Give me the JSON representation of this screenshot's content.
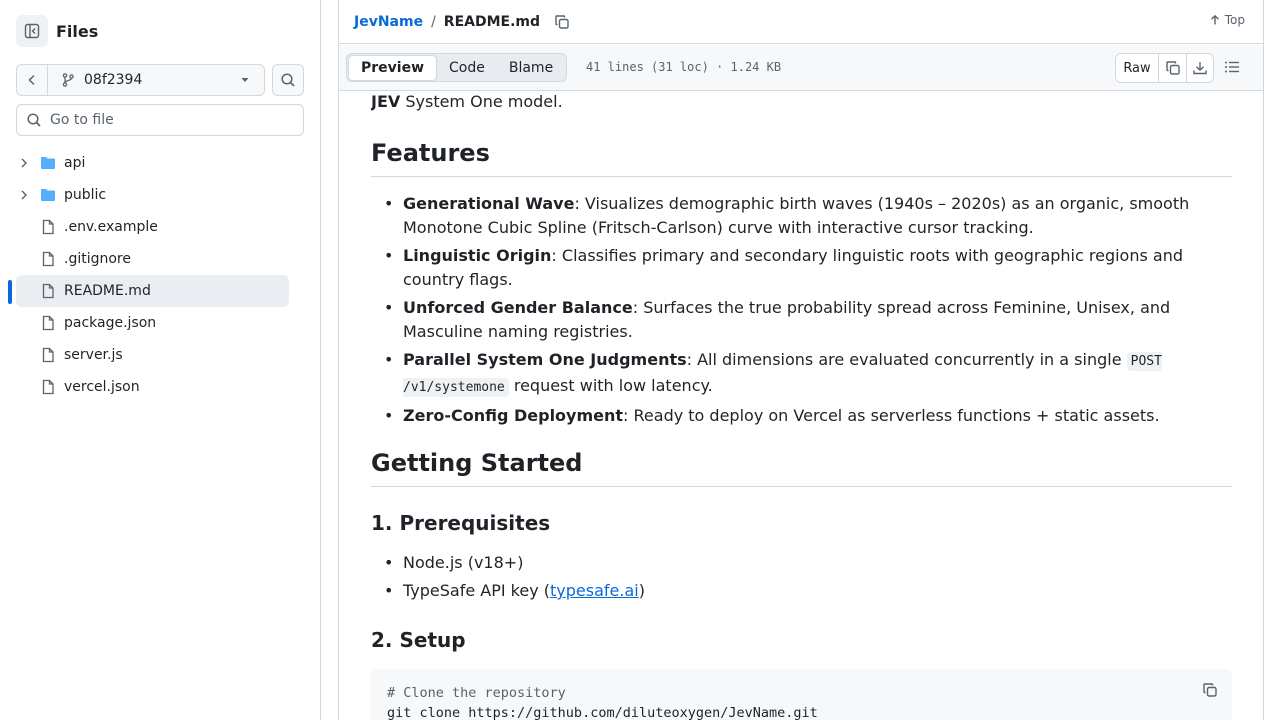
{
  "sidebar": {
    "title": "Files",
    "branch": "08f2394",
    "goto_placeholder": "Go to file",
    "items": [
      {
        "label": "api",
        "type": "folder"
      },
      {
        "label": "public",
        "type": "folder"
      },
      {
        "label": ".env.example",
        "type": "file"
      },
      {
        "label": ".gitignore",
        "type": "file"
      },
      {
        "label": "README.md",
        "type": "file",
        "selected": true
      },
      {
        "label": "package.json",
        "type": "file"
      },
      {
        "label": "server.js",
        "type": "file"
      },
      {
        "label": "vercel.json",
        "type": "file"
      }
    ]
  },
  "header": {
    "repo": "JevName",
    "separator": "/",
    "file": "README.md",
    "top_label": "Top"
  },
  "toolbar": {
    "tabs": [
      {
        "label": "Preview",
        "active": true
      },
      {
        "label": "Code",
        "active": false
      },
      {
        "label": "Blame",
        "active": false
      }
    ],
    "file_meta": "41 lines (31 loc) · 1.24 KB",
    "raw_label": "Raw"
  },
  "content": {
    "intro_bold": "JEV",
    "intro_rest": " System One model.",
    "features_heading": "Features",
    "features": [
      {
        "bold": "Generational Wave",
        "text": ": Visualizes demographic birth waves (1940s – 2020s) as an organic, smooth Monotone Cubic Spline (Fritsch-Carlson) curve with interactive cursor tracking."
      },
      {
        "bold": "Linguistic Origin",
        "text": ": Classifies primary and secondary linguistic roots with geographic regions and country flags."
      },
      {
        "bold": "Unforced Gender Balance",
        "text": ": Surfaces the true probability spread across Feminine, Unisex, and Masculine naming registries."
      },
      {
        "bold": "Parallel System One Judgments",
        "text_before": ": All dimensions are evaluated concurrently in a single ",
        "code": "POST /v1/systemone",
        "text_after": " request with low latency."
      },
      {
        "bold": "Zero-Config Deployment",
        "text": ": Ready to deploy on Vercel as serverless functions + static assets."
      }
    ],
    "getting_started_heading": "Getting Started",
    "prereq_heading": "1. Prerequisites",
    "prereq_node": "Node.js (v18+)",
    "prereq_key_before": "TypeSafe API key (",
    "prereq_key_link": "typesafe.ai",
    "prereq_key_after": ")",
    "setup_heading": "2. Setup",
    "code_comment": "# Clone the repository",
    "code_line": "git clone https://github.com/diluteoxygen/JevName.git"
  },
  "colors": {
    "accent": "#0969da",
    "border": "#d1d9e0",
    "folder": "#54aeff",
    "muted": "#59636e"
  }
}
